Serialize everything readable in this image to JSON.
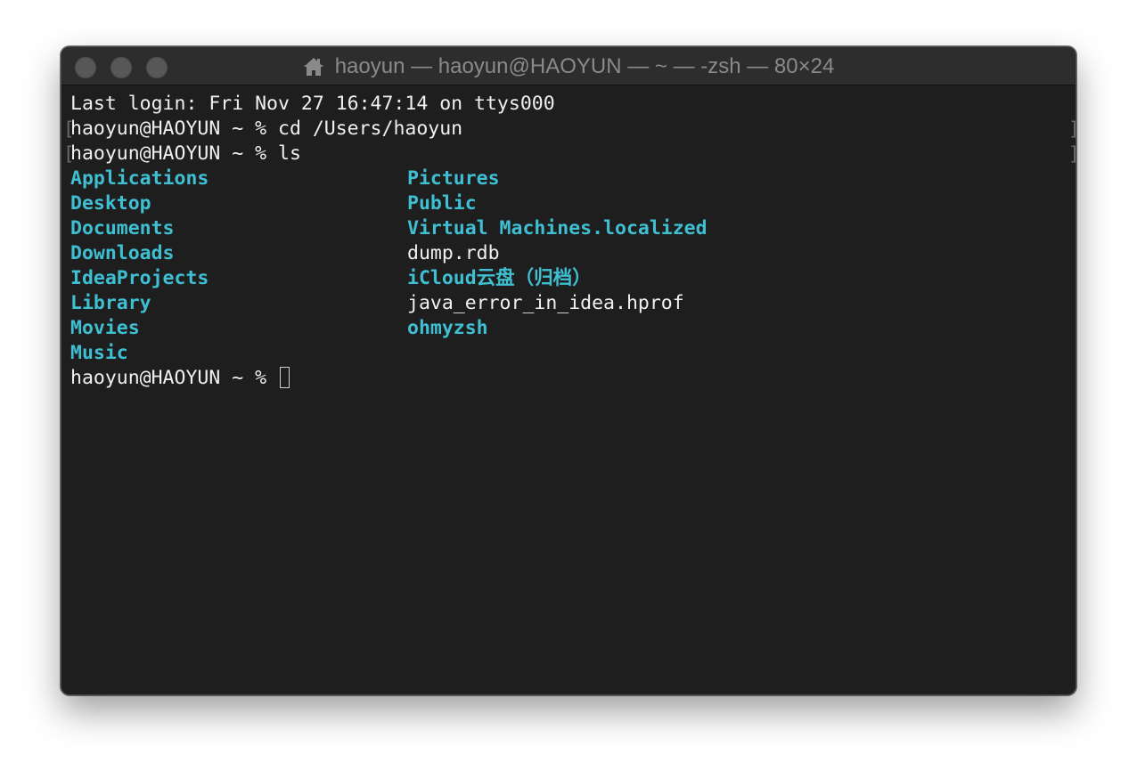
{
  "window": {
    "title": "haoyun — haoyun@HAOYUN — ~ — -zsh — 80×24",
    "title_icon": "home-icon",
    "traffic_lights": [
      "close-button",
      "minimize-button",
      "zoom-button"
    ]
  },
  "terminal": {
    "last_login": "Last login: Fri Nov 27 16:47:14 on ttys000",
    "prompt": "haoyun@HAOYUN ~ % ",
    "commands": [
      "cd /Users/haoyun",
      "ls"
    ],
    "ls_column1": [
      {
        "name": "Applications",
        "type": "dir"
      },
      {
        "name": "Desktop",
        "type": "dir"
      },
      {
        "name": "Documents",
        "type": "dir"
      },
      {
        "name": "Downloads",
        "type": "dir"
      },
      {
        "name": "IdeaProjects",
        "type": "dir"
      },
      {
        "name": "Library",
        "type": "dir"
      },
      {
        "name": "Movies",
        "type": "dir"
      },
      {
        "name": "Music",
        "type": "dir"
      }
    ],
    "ls_column2": [
      {
        "name": "Pictures",
        "type": "dir"
      },
      {
        "name": "Public",
        "type": "dir"
      },
      {
        "name": "Virtual Machines.localized",
        "type": "dir"
      },
      {
        "name": "dump.rdb",
        "type": "file"
      },
      {
        "name": "iCloud云盘（归档）",
        "type": "dir"
      },
      {
        "name": "java_error_in_idea.hprof",
        "type": "file"
      },
      {
        "name": "ohmyzsh",
        "type": "dir"
      }
    ],
    "final_prompt": "haoyun@HAOYUN ~ % "
  },
  "colors": {
    "background": "#1e1e1e",
    "titlebar": "#2d2d2d",
    "text": "#f0f0f0",
    "directory": "#3fbfd2"
  }
}
